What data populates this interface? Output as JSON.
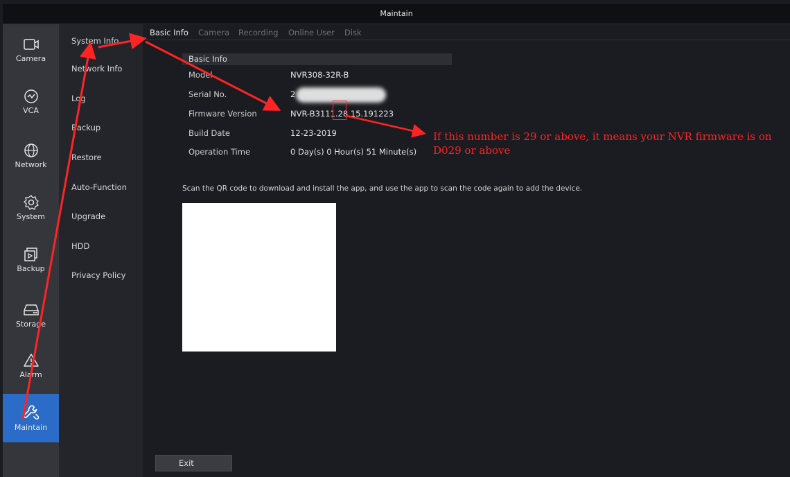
{
  "window": {
    "title": "Maintain"
  },
  "iconbar": {
    "items": [
      {
        "label": "Camera",
        "icon": "camera-icon"
      },
      {
        "label": "VCA",
        "icon": "vca-icon"
      },
      {
        "label": "Network",
        "icon": "globe-icon"
      },
      {
        "label": "System",
        "icon": "gear-icon"
      },
      {
        "label": "Backup",
        "icon": "backup-icon"
      },
      {
        "label": "Storage",
        "icon": "storage-icon"
      },
      {
        "label": "Alarm",
        "icon": "alarm-icon"
      },
      {
        "label": "Maintain",
        "icon": "wrench-icon",
        "active": true
      }
    ]
  },
  "sidebar": {
    "items": [
      {
        "label": "System Info"
      },
      {
        "label": "Network Info"
      },
      {
        "label": "Log"
      },
      {
        "label": "Backup"
      },
      {
        "label": "Restore"
      },
      {
        "label": "Auto-Function"
      },
      {
        "label": "Upgrade"
      },
      {
        "label": "HDD"
      },
      {
        "label": "Privacy Policy"
      }
    ]
  },
  "tabs": [
    {
      "label": "Basic Info",
      "active": true
    },
    {
      "label": "Camera"
    },
    {
      "label": "Recording"
    },
    {
      "label": "Online User"
    },
    {
      "label": "Disk"
    }
  ],
  "basic_info": {
    "heading": "Basic Info",
    "rows": [
      {
        "key": "Model",
        "value": "NVR308-32R-B"
      },
      {
        "key": "Serial No.",
        "value": "2"
      },
      {
        "key": "Firmware Version",
        "value": "NVR-B3111.28.15.191223"
      },
      {
        "key": "Build Date",
        "value": "12-23-2019"
      },
      {
        "key": "Operation Time",
        "value": "0 Day(s) 0 Hour(s) 51 Minute(s)"
      }
    ]
  },
  "annotation": {
    "text": "If this number is 29 or above, it means your NVR firmware is on D029 or above",
    "color": "#ff2424"
  },
  "qr": {
    "instructions": "Scan the QR code to download and install the app, and use the app to scan the code again to add the device."
  },
  "footer": {
    "exit_label": "Exit"
  },
  "colors": {
    "active_nav": "#2a6cc8",
    "annotation": "#ff2424"
  }
}
